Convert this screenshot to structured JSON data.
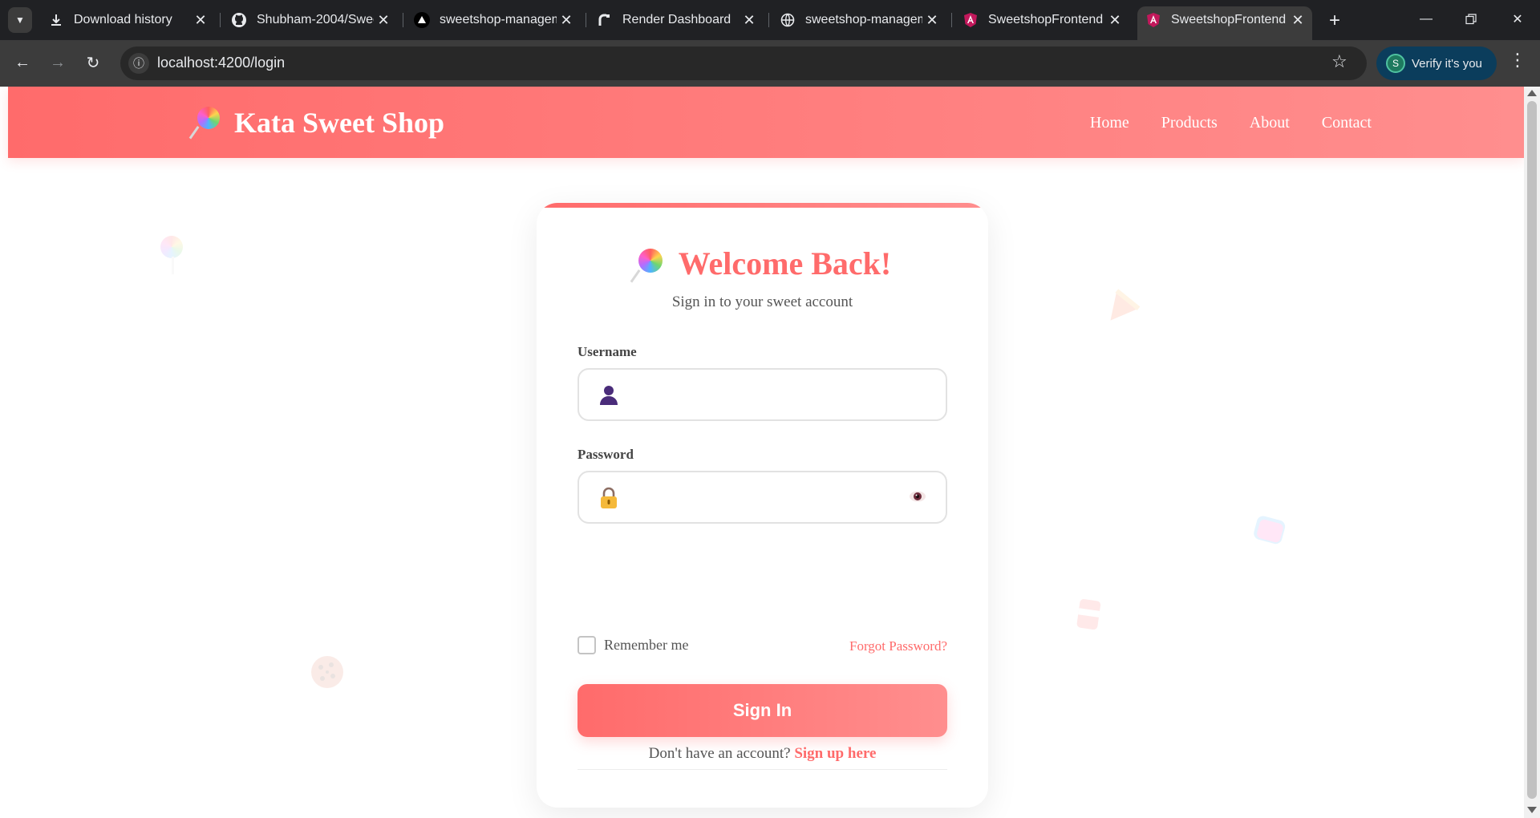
{
  "browser": {
    "tabs": [
      {
        "title": "Download history",
        "icon": "download-icon",
        "active": false
      },
      {
        "title": "Shubham-2004/Swee",
        "icon": "github-icon",
        "active": false
      },
      {
        "title": "sweetshop-managem",
        "icon": "vercel-icon",
        "active": false
      },
      {
        "title": "Render Dashboard",
        "icon": "render-icon",
        "active": false
      },
      {
        "title": "sweetshop-managem",
        "icon": "globe-icon",
        "active": false
      },
      {
        "title": "SweetshopFrontend",
        "icon": "angular-icon",
        "active": false
      },
      {
        "title": "SweetshopFrontend",
        "icon": "angular-icon",
        "active": true
      }
    ],
    "url": "localhost:4200/login",
    "profile_button": "Verify it's you",
    "profile_initial": "S"
  },
  "header": {
    "brand": "Kata Sweet Shop",
    "nav": [
      "Home",
      "Products",
      "About",
      "Contact"
    ]
  },
  "login": {
    "title": "Welcome Back!",
    "subtitle": "Sign in to your sweet account",
    "username_label": "Username",
    "username_value": "",
    "password_label": "Password",
    "password_value": "",
    "remember_label": "Remember me",
    "remember_checked": false,
    "forgot_link": "Forgot Password?",
    "submit_label": "Sign In",
    "signup_prompt": "Don't have an account?",
    "signup_link": "Sign up here"
  },
  "colors": {
    "brand": "#ff6b6b",
    "brand_light": "#ff8e8e",
    "tab_bar": "#202124",
    "toolbar": "#3c3c3c"
  }
}
